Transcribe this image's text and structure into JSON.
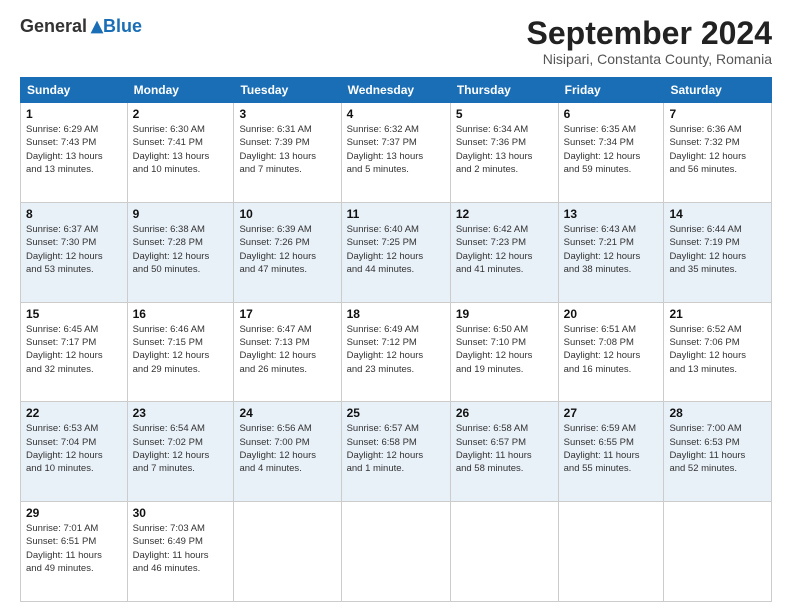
{
  "header": {
    "logo_general": "General",
    "logo_blue": "Blue",
    "month": "September 2024",
    "location": "Nisipari, Constanta County, Romania"
  },
  "days_of_week": [
    "Sunday",
    "Monday",
    "Tuesday",
    "Wednesday",
    "Thursday",
    "Friday",
    "Saturday"
  ],
  "weeks": [
    [
      {
        "day": "1",
        "info": "Sunrise: 6:29 AM\nSunset: 7:43 PM\nDaylight: 13 hours\nand 13 minutes."
      },
      {
        "day": "2",
        "info": "Sunrise: 6:30 AM\nSunset: 7:41 PM\nDaylight: 13 hours\nand 10 minutes."
      },
      {
        "day": "3",
        "info": "Sunrise: 6:31 AM\nSunset: 7:39 PM\nDaylight: 13 hours\nand 7 minutes."
      },
      {
        "day": "4",
        "info": "Sunrise: 6:32 AM\nSunset: 7:37 PM\nDaylight: 13 hours\nand 5 minutes."
      },
      {
        "day": "5",
        "info": "Sunrise: 6:34 AM\nSunset: 7:36 PM\nDaylight: 13 hours\nand 2 minutes."
      },
      {
        "day": "6",
        "info": "Sunrise: 6:35 AM\nSunset: 7:34 PM\nDaylight: 12 hours\nand 59 minutes."
      },
      {
        "day": "7",
        "info": "Sunrise: 6:36 AM\nSunset: 7:32 PM\nDaylight: 12 hours\nand 56 minutes."
      }
    ],
    [
      {
        "day": "8",
        "info": "Sunrise: 6:37 AM\nSunset: 7:30 PM\nDaylight: 12 hours\nand 53 minutes."
      },
      {
        "day": "9",
        "info": "Sunrise: 6:38 AM\nSunset: 7:28 PM\nDaylight: 12 hours\nand 50 minutes."
      },
      {
        "day": "10",
        "info": "Sunrise: 6:39 AM\nSunset: 7:26 PM\nDaylight: 12 hours\nand 47 minutes."
      },
      {
        "day": "11",
        "info": "Sunrise: 6:40 AM\nSunset: 7:25 PM\nDaylight: 12 hours\nand 44 minutes."
      },
      {
        "day": "12",
        "info": "Sunrise: 6:42 AM\nSunset: 7:23 PM\nDaylight: 12 hours\nand 41 minutes."
      },
      {
        "day": "13",
        "info": "Sunrise: 6:43 AM\nSunset: 7:21 PM\nDaylight: 12 hours\nand 38 minutes."
      },
      {
        "day": "14",
        "info": "Sunrise: 6:44 AM\nSunset: 7:19 PM\nDaylight: 12 hours\nand 35 minutes."
      }
    ],
    [
      {
        "day": "15",
        "info": "Sunrise: 6:45 AM\nSunset: 7:17 PM\nDaylight: 12 hours\nand 32 minutes."
      },
      {
        "day": "16",
        "info": "Sunrise: 6:46 AM\nSunset: 7:15 PM\nDaylight: 12 hours\nand 29 minutes."
      },
      {
        "day": "17",
        "info": "Sunrise: 6:47 AM\nSunset: 7:13 PM\nDaylight: 12 hours\nand 26 minutes."
      },
      {
        "day": "18",
        "info": "Sunrise: 6:49 AM\nSunset: 7:12 PM\nDaylight: 12 hours\nand 23 minutes."
      },
      {
        "day": "19",
        "info": "Sunrise: 6:50 AM\nSunset: 7:10 PM\nDaylight: 12 hours\nand 19 minutes."
      },
      {
        "day": "20",
        "info": "Sunrise: 6:51 AM\nSunset: 7:08 PM\nDaylight: 12 hours\nand 16 minutes."
      },
      {
        "day": "21",
        "info": "Sunrise: 6:52 AM\nSunset: 7:06 PM\nDaylight: 12 hours\nand 13 minutes."
      }
    ],
    [
      {
        "day": "22",
        "info": "Sunrise: 6:53 AM\nSunset: 7:04 PM\nDaylight: 12 hours\nand 10 minutes."
      },
      {
        "day": "23",
        "info": "Sunrise: 6:54 AM\nSunset: 7:02 PM\nDaylight: 12 hours\nand 7 minutes."
      },
      {
        "day": "24",
        "info": "Sunrise: 6:56 AM\nSunset: 7:00 PM\nDaylight: 12 hours\nand 4 minutes."
      },
      {
        "day": "25",
        "info": "Sunrise: 6:57 AM\nSunset: 6:58 PM\nDaylight: 12 hours\nand 1 minute."
      },
      {
        "day": "26",
        "info": "Sunrise: 6:58 AM\nSunset: 6:57 PM\nDaylight: 11 hours\nand 58 minutes."
      },
      {
        "day": "27",
        "info": "Sunrise: 6:59 AM\nSunset: 6:55 PM\nDaylight: 11 hours\nand 55 minutes."
      },
      {
        "day": "28",
        "info": "Sunrise: 7:00 AM\nSunset: 6:53 PM\nDaylight: 11 hours\nand 52 minutes."
      }
    ],
    [
      {
        "day": "29",
        "info": "Sunrise: 7:01 AM\nSunset: 6:51 PM\nDaylight: 11 hours\nand 49 minutes."
      },
      {
        "day": "30",
        "info": "Sunrise: 7:03 AM\nSunset: 6:49 PM\nDaylight: 11 hours\nand 46 minutes."
      },
      {
        "day": "",
        "info": ""
      },
      {
        "day": "",
        "info": ""
      },
      {
        "day": "",
        "info": ""
      },
      {
        "day": "",
        "info": ""
      },
      {
        "day": "",
        "info": ""
      }
    ]
  ]
}
